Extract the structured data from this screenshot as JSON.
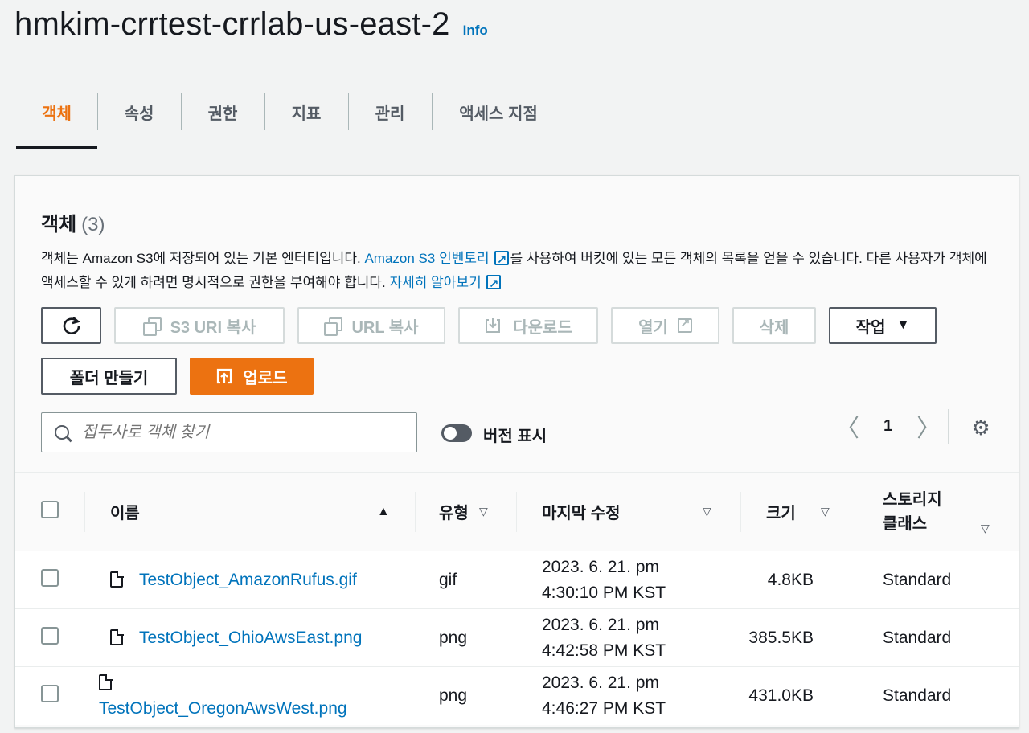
{
  "header": {
    "title": "hmkim-crrtest-crrlab-us-east-2",
    "info": "Info"
  },
  "tabs": [
    {
      "label": "객체"
    },
    {
      "label": "속성"
    },
    {
      "label": "권한"
    },
    {
      "label": "지표"
    },
    {
      "label": "관리"
    },
    {
      "label": "액세스 지점"
    }
  ],
  "panel": {
    "title": "객체",
    "count": "(3)",
    "desc_part1": "객체는 Amazon S3에 저장되어 있는 기본 엔터티입니다. ",
    "desc_link1": "Amazon S3 인벤토리",
    "desc_part2": "를 사용하여 버킷에 있는 모든 객체의 목록을 얻을 수 있습니다. 다른 사용자가 객체에 액세스할 수 있게 하려면 명시적으로 권한을 부여해야 합니다. ",
    "desc_link2": "자세히 알아보기"
  },
  "toolbar": {
    "copy_s3_uri": "S3 URI 복사",
    "copy_url": "URL 복사",
    "download": "다운로드",
    "open": "열기",
    "delete": "삭제",
    "actions": "작업",
    "create_folder": "폴더 만들기",
    "upload": "업로드"
  },
  "search": {
    "placeholder": "접두사로 객체 찾기"
  },
  "versions_toggle": {
    "label": "버전 표시",
    "on": false
  },
  "pagination": {
    "page": "1"
  },
  "table": {
    "headers": {
      "name": "이름",
      "type": "유형",
      "modified": "마지막 수정",
      "size": "크기",
      "storage_line1": "스토리지",
      "storage_line2": "클래스"
    },
    "rows": [
      {
        "name": "TestObject_AmazonRufus.gif",
        "type": "gif",
        "modified_line1": "2023. 6. 21. pm",
        "modified_line2": "4:30:10 PM KST",
        "size": "4.8KB",
        "storage": "Standard"
      },
      {
        "name": "TestObject_OhioAwsEast.png",
        "type": "png",
        "modified_line1": "2023. 6. 21. pm",
        "modified_line2": "4:42:58 PM KST",
        "size": "385.5KB",
        "storage": "Standard"
      },
      {
        "name": "TestObject_OregonAwsWest.png",
        "type": "png",
        "modified_line1": "2023. 6. 21. pm",
        "modified_line2": "4:46:27 PM KST",
        "size": "431.0KB",
        "storage": "Standard"
      }
    ]
  },
  "colors": {
    "accent": "#ec7211",
    "link": "#0073bb",
    "text": "#16191f"
  }
}
